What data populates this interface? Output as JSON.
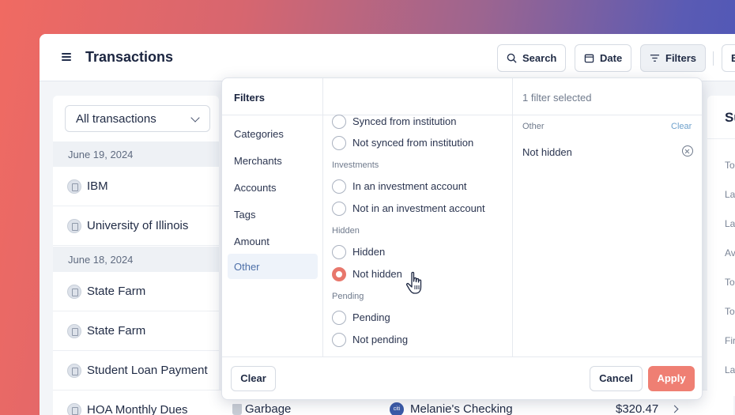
{
  "header": {
    "title": "Transactions",
    "buttons": {
      "search": "Search",
      "date": "Date",
      "filters": "Filters",
      "extra": "E"
    }
  },
  "list": {
    "dropdown": "All transactions",
    "groups": [
      {
        "date": "June 19, 2024",
        "items": [
          "IBM",
          "University of Illinois"
        ]
      },
      {
        "date": "June 18, 2024",
        "items": [
          "State Farm",
          "State Farm",
          "Student Loan Payment",
          "HOA Monthly Dues"
        ]
      }
    ],
    "bottom_row": {
      "category": "Garbage",
      "account": "Melanie's Checking",
      "account_icon": "citi",
      "amount": "$320.47"
    }
  },
  "summary": {
    "title": "Su",
    "labels": [
      "To",
      "La",
      "La",
      "Av",
      "To",
      "To",
      "Fir",
      "La"
    ]
  },
  "filters": {
    "title": "Filters",
    "nav": [
      "Categories",
      "Merchants",
      "Accounts",
      "Tags",
      "Amount",
      "Other"
    ],
    "selected_nav": "Other",
    "options": {
      "synced": "Synced from institution",
      "not_synced": "Not synced from institution",
      "investments_label": "Investments",
      "in_investment": "In an investment account",
      "not_in_investment": "Not in an investment account",
      "hidden_label": "Hidden",
      "hidden": "Hidden",
      "not_hidden": "Not hidden",
      "pending_label": "Pending",
      "pending": "Pending",
      "not_pending": "Not pending"
    },
    "selected_count": "1 filter selected",
    "selected_group": "Other",
    "clear_link": "Clear",
    "selected_chip": "Not hidden",
    "footer": {
      "clear": "Clear",
      "cancel": "Cancel",
      "apply": "Apply"
    }
  },
  "colors": {
    "accent": "#ef7f73",
    "nav_selected": "#4d6fa8",
    "link": "#6ea1cc"
  }
}
